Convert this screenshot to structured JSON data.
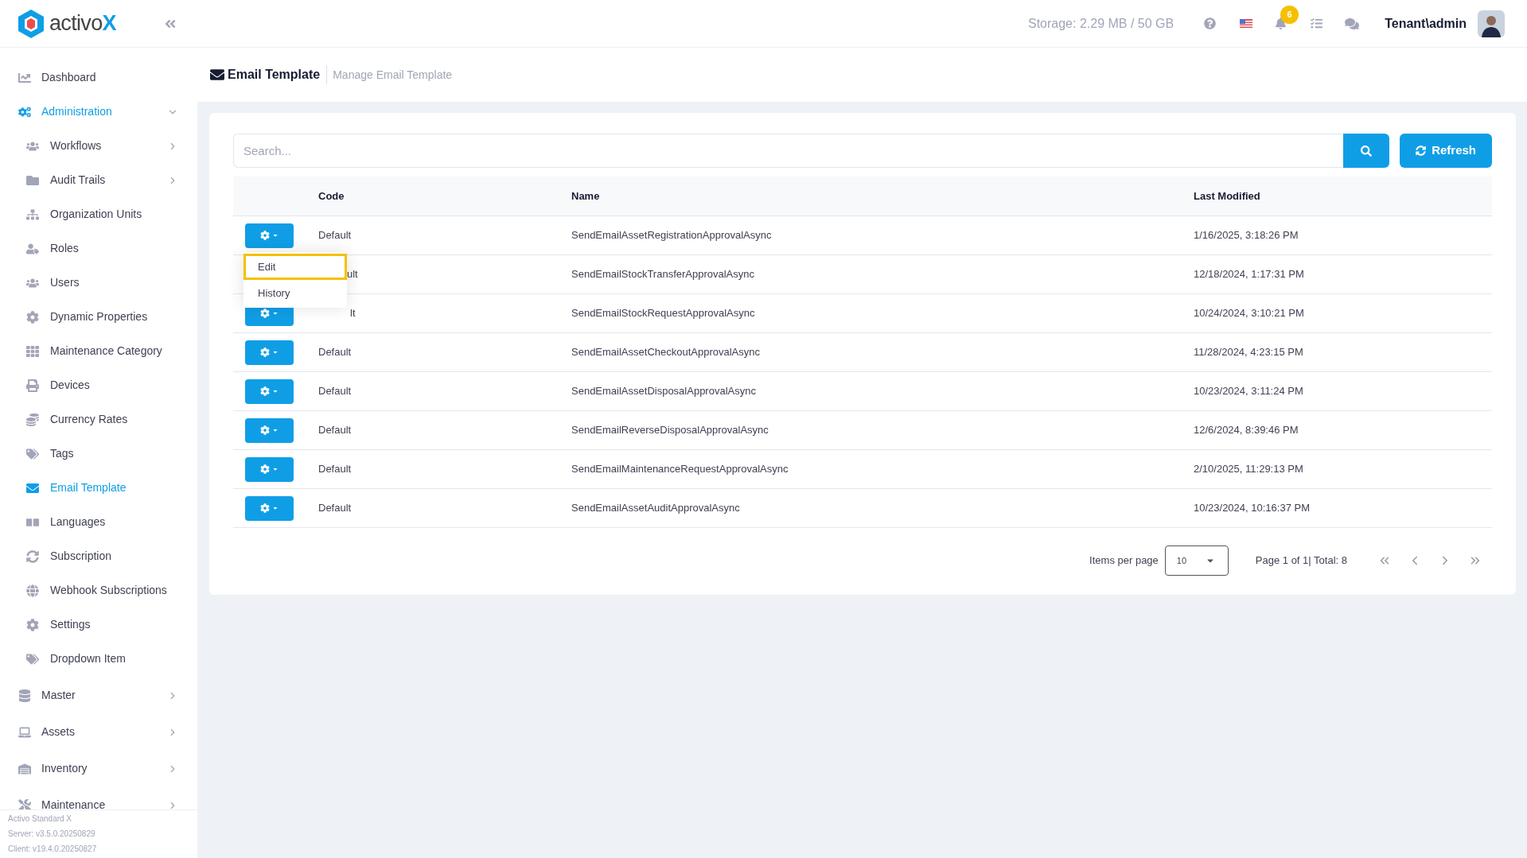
{
  "brand": {
    "name_main": "activo",
    "name_accent": "X"
  },
  "sidebar": {
    "items": [
      {
        "label": "Dashboard",
        "selected": false,
        "has_children": false
      },
      {
        "label": "Administration",
        "selected": true,
        "has_children": true,
        "expanded": true,
        "children": [
          {
            "label": "Workflows",
            "selected": false,
            "has_children": true
          },
          {
            "label": "Audit Trails",
            "selected": false,
            "has_children": true
          },
          {
            "label": "Organization Units",
            "selected": false,
            "has_children": false
          },
          {
            "label": "Roles",
            "selected": false,
            "has_children": false
          },
          {
            "label": "Users",
            "selected": false,
            "has_children": false
          },
          {
            "label": "Dynamic Properties",
            "selected": false,
            "has_children": false
          },
          {
            "label": "Maintenance Category",
            "selected": false,
            "has_children": false
          },
          {
            "label": "Devices",
            "selected": false,
            "has_children": false
          },
          {
            "label": "Currency Rates",
            "selected": false,
            "has_children": false
          },
          {
            "label": "Tags",
            "selected": false,
            "has_children": false
          },
          {
            "label": "Email Template",
            "selected": true,
            "has_children": false
          },
          {
            "label": "Languages",
            "selected": false,
            "has_children": false
          },
          {
            "label": "Subscription",
            "selected": false,
            "has_children": false
          },
          {
            "label": "Webhook Subscriptions",
            "selected": false,
            "has_children": false
          },
          {
            "label": "Settings",
            "selected": false,
            "has_children": false
          },
          {
            "label": "Dropdown Item",
            "selected": false,
            "has_children": false
          }
        ]
      },
      {
        "label": "Master",
        "selected": false,
        "has_children": true,
        "expanded": false
      },
      {
        "label": "Assets",
        "selected": false,
        "has_children": true,
        "expanded": false
      },
      {
        "label": "Inventory",
        "selected": false,
        "has_children": true,
        "expanded": false
      },
      {
        "label": "Maintenance",
        "selected": false,
        "has_children": true,
        "expanded": false
      }
    ],
    "footer": [
      "Activo Standard X",
      "Server: v3.5.0.20250829",
      "Client: v19.4.0.20250827"
    ]
  },
  "header": {
    "storage": "Storage: 2.29 MB / 50 GB",
    "notification_count": "6",
    "user": "Tenant\\admin"
  },
  "page": {
    "title": "Email Template",
    "subtitle": "Manage Email Template"
  },
  "search": {
    "placeholder": "Search..."
  },
  "refresh_button": "Refresh",
  "table": {
    "columns": [
      "Code",
      "Name",
      "Last Modified"
    ],
    "rows": [
      {
        "code": "Default",
        "name": "SendEmailAssetRegistrationApprovalAsync",
        "modified": "1/16/2025, 3:18:26 PM"
      },
      {
        "code": "ult",
        "name": "SendEmailStockTransferApprovalAsync",
        "modified": "12/18/2024, 1:17:31 PM"
      },
      {
        "code": "lt",
        "name": "SendEmailStockRequestApprovalAsync",
        "modified": "10/24/2024, 3:10:21 PM"
      },
      {
        "code": "Default",
        "name": "SendEmailAssetCheckoutApprovalAsync",
        "modified": "11/28/2024, 4:23:15 PM"
      },
      {
        "code": "Default",
        "name": "SendEmailAssetDisposalApprovalAsync",
        "modified": "10/23/2024, 3:11:24 PM"
      },
      {
        "code": "Default",
        "name": "SendEmailReverseDisposalApprovalAsync",
        "modified": "12/6/2024, 8:39:46 PM"
      },
      {
        "code": "Default",
        "name": "SendEmailMaintenanceRequestApprovalAsync",
        "modified": "2/10/2025, 11:29:13 PM"
      },
      {
        "code": "Default",
        "name": "SendEmailAssetAuditApprovalAsync",
        "modified": "10/23/2024, 10:16:37 PM"
      }
    ]
  },
  "action_menu": {
    "items": [
      {
        "label": "Edit",
        "selected": true
      },
      {
        "label": "History",
        "selected": false
      }
    ]
  },
  "pagination": {
    "items_per_page_label": "Items per page",
    "items_per_page": "10",
    "summary": "Page 1 of 1| Total: 8"
  }
}
